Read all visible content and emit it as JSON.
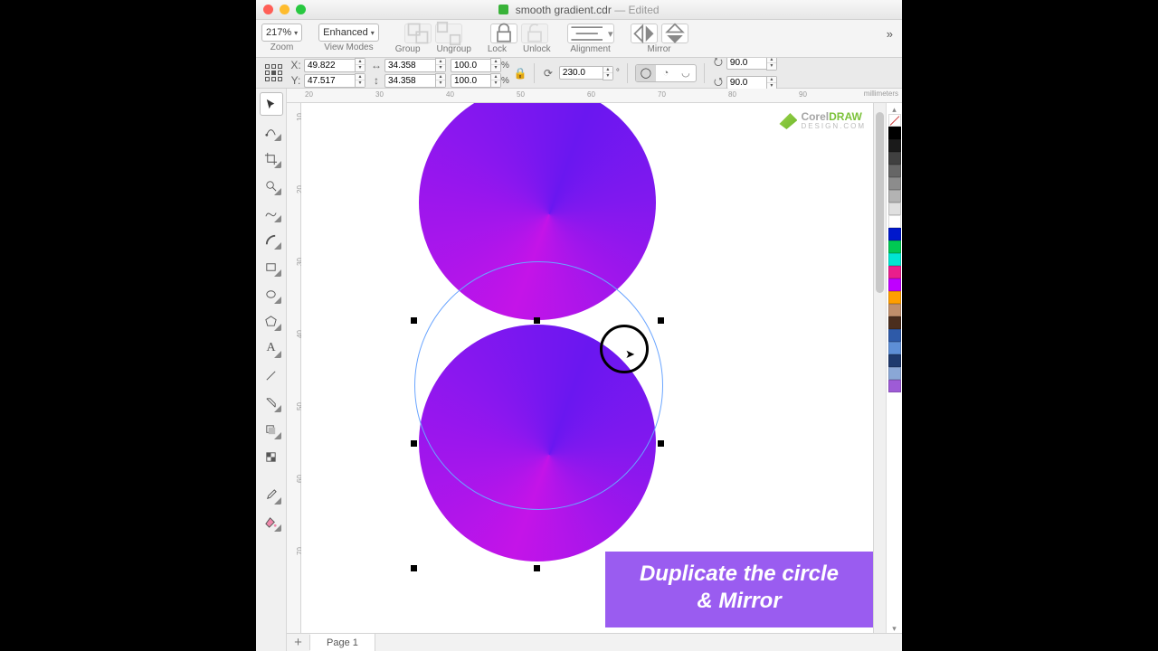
{
  "window": {
    "filename": "smooth gradient.cdr",
    "edited_suffix": "— Edited"
  },
  "toolbar": {
    "zoom": {
      "value": "217%",
      "label": "Zoom"
    },
    "viewmode": {
      "value": "Enhanced",
      "label": "View Modes"
    },
    "group": {
      "label": "Group"
    },
    "ungroup": {
      "label": "Ungroup"
    },
    "lock": {
      "label": "Lock"
    },
    "unlock": {
      "label": "Unlock"
    },
    "alignment": {
      "label": "Alignment"
    },
    "mirror": {
      "label": "Mirror"
    }
  },
  "props": {
    "x_label": "X:",
    "y_label": "Y:",
    "x": "49.822",
    "y": "47.517",
    "w": "34.358",
    "h": "34.358",
    "scale_x": "100.0",
    "scale_y": "100.0",
    "pct": "%",
    "rotation": "230.0",
    "rot_unit": "°",
    "skew_tx": "90.0",
    "skew_ty": "90.0"
  },
  "ruler": {
    "unit": "millimeters",
    "h_marks": [
      "20",
      "30",
      "40",
      "50",
      "60",
      "70",
      "80",
      "90"
    ],
    "v_marks": [
      "10",
      "20",
      "30",
      "40",
      "50",
      "60",
      "70"
    ]
  },
  "palette_colors": [
    "#000000",
    "#1a1a1a",
    "#404040",
    "#666666",
    "#8c8c8c",
    "#b3b3b3",
    "#e0e0e0",
    "#ffffff",
    "#0018cc",
    "#00c853",
    "#00e5d1",
    "#e91e8c",
    "#bf00ff",
    "#ff9e00",
    "#c18f6b",
    "#4b2e1e",
    "#2e5aa8",
    "#5e8fd6",
    "#1f3a6e",
    "#8aa7d6",
    "#9e5bd6"
  ],
  "watermark": {
    "brand1": "Corel",
    "brand2": "DRAW",
    "tag": "DESIGN.COM"
  },
  "caption": {
    "line1": "Duplicate the circle",
    "line2": "& Mirror"
  },
  "pages": {
    "add": "+",
    "tab1": "Page 1"
  },
  "tools": [
    "pick-tool",
    "shape-tool",
    "crop-tool",
    "zoom-tool",
    "freehand-tool",
    "artistic-media-tool",
    "rectangle-tool",
    "ellipse-tool",
    "polygon-tool",
    "text-tool",
    "line-tool",
    "interactive-fill-tool",
    "drop-shadow-tool",
    "transparency-tool",
    "color-eyedropper-tool",
    "fill-tool"
  ]
}
